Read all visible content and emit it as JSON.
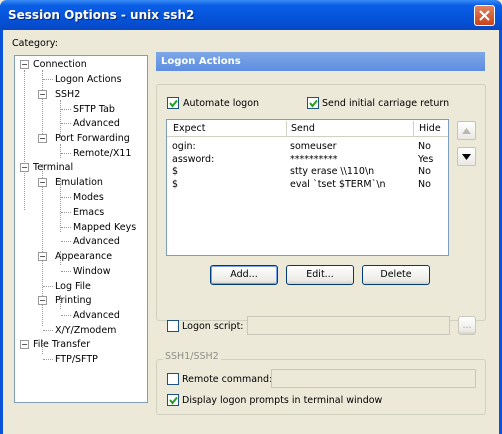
{
  "window": {
    "title": "Session Options - unix ssh2"
  },
  "category_label": "Category:",
  "tree": {
    "connection": "Connection",
    "logon_actions": "Logon Actions",
    "ssh2": "SSH2",
    "sftp_tab": "SFTP Tab",
    "ssh2_advanced": "Advanced",
    "port_forwarding": "Port Forwarding",
    "remote_x11": "Remote/X11",
    "terminal": "Terminal",
    "emulation": "Emulation",
    "modes": "Modes",
    "emacs": "Emacs",
    "mapped_keys": "Mapped Keys",
    "emulation_advanced": "Advanced",
    "appearance": "Appearance",
    "window": "Window",
    "log_file": "Log File",
    "printing": "Printing",
    "printing_advanced": "Advanced",
    "xyzmodem": "X/Y/Zmodem",
    "file_transfer": "File Transfer",
    "ftp_sftp": "FTP/SFTP"
  },
  "panel": {
    "header": "Logon Actions",
    "automate_logon": {
      "label": "Automate logon",
      "checked": true
    },
    "send_cr": {
      "label": "Send initial carriage return",
      "checked": true
    },
    "columns": {
      "expect": "Expect",
      "send": "Send",
      "hide": "Hide"
    },
    "rows": [
      {
        "expect": "ogin:",
        "send": "someuser",
        "hide": "No"
      },
      {
        "expect": "assword:",
        "send": "**********",
        "hide": "Yes"
      },
      {
        "expect": "$",
        "send": "stty erase \\\\110\\n",
        "hide": "No"
      },
      {
        "expect": "$",
        "send": "eval `tset $TERM`\\n",
        "hide": "No"
      }
    ],
    "buttons": {
      "add": "Add...",
      "edit": "Edit...",
      "delete": "Delete"
    },
    "logon_script": {
      "label": "Logon script:",
      "checked": false,
      "value": "",
      "browse": "..."
    },
    "ssh_group": {
      "title": "SSH1/SSH2",
      "remote_command": {
        "label": "Remote command:",
        "checked": false,
        "value": ""
      },
      "display_prompts": {
        "label": "Display logon prompts in terminal window",
        "checked": true
      }
    }
  },
  "colors": {
    "title_bar": "#0553d9",
    "panel_header": "#6b97e2",
    "dialog_bg": "#ece9d8",
    "check_green": "#21a121"
  },
  "icons": [
    "close-icon",
    "checkmark-icon",
    "up-arrow-icon",
    "down-arrow-icon"
  ]
}
